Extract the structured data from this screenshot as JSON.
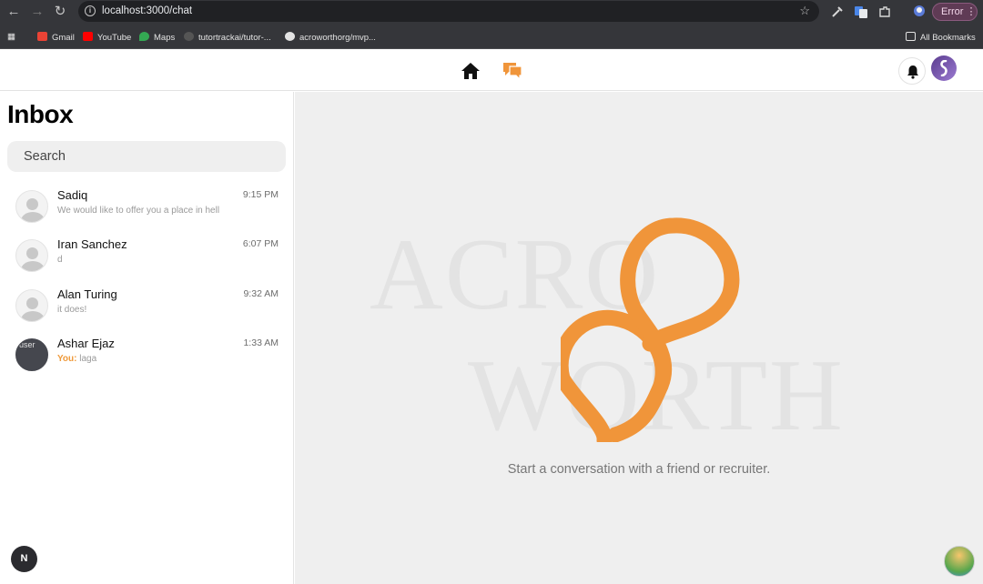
{
  "browser": {
    "url": "localhost:3000/chat",
    "error_label": "Error ⋮",
    "bookmarks": [
      "Gmail",
      "YouTube",
      "Maps",
      "tutortrackai/tutor-...",
      "acroworthorg/mvp..."
    ],
    "all_bookmarks": "All Bookmarks"
  },
  "sidebar": {
    "title": "Inbox",
    "search_placeholder": "Search",
    "conversations": [
      {
        "name": "Sadiq",
        "time": "9:15 PM",
        "preview": "We would like to offer you a place in hell",
        "you": ""
      },
      {
        "name": "Iran Sanchez",
        "time": "6:07 PM",
        "preview": "d",
        "you": ""
      },
      {
        "name": "Alan Turing",
        "time": "9:32 AM",
        "preview": "it does!",
        "you": ""
      },
      {
        "name": "Ashar Ejaz",
        "time": "1:33 AM",
        "preview": "laga",
        "you": "You:",
        "avatar_alt": "user"
      }
    ],
    "next_badge": "N"
  },
  "main": {
    "watermark_line1": "ACRO",
    "watermark_line2": "WORTH",
    "empty_message": "Start a conversation with a friend or recruiter."
  },
  "colors": {
    "accent": "#f0953a",
    "sidebar_bg": "#ffffff",
    "main_bg": "#efefef"
  }
}
